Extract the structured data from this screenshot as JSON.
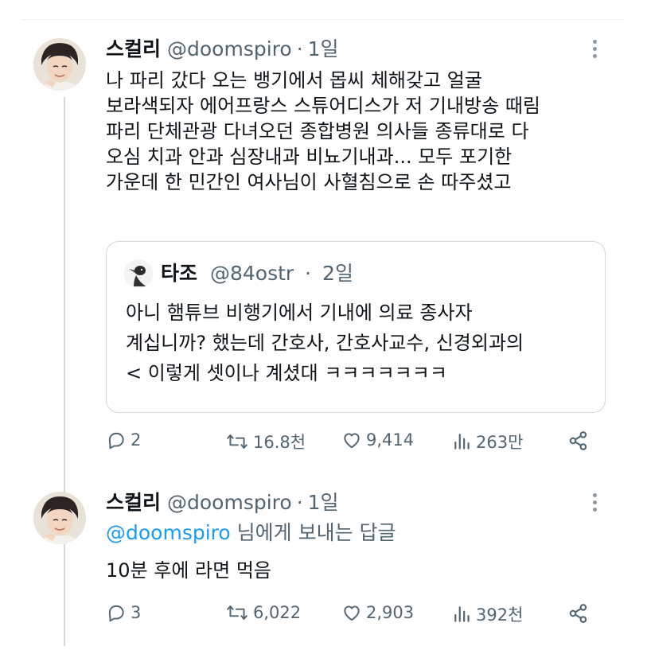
{
  "tweets": [
    {
      "name": "스컬리",
      "handle": "@doomspiro",
      "separator": "·",
      "time": "1일",
      "lines": [
        "나 파리 갔다 오는 뱅기에서 몹씨 체해갖고 얼굴",
        "보라색되자 에어프랑스 스튜어디스가 저 기내방송 때림",
        "파리 단체관광 다녀오던 종합병원 의사들 종류대로 다",
        "오심 치과 안과 심장내과 비뇨기내과... 모두 포기한",
        "가운데 한 민간인 여사님이 사혈침으로 손 따주셨고"
      ],
      "quote": {
        "name": "타조",
        "handle": "@84ostr",
        "separator": "·",
        "time": "2일",
        "lines": [
          "아니 햄튜브 비행기에서 기내에 의료 종사자",
          "계십니까? 했는데 간호사, 간호사교수, 신경외과의",
          "< 이렇게 셋이나 계셨대 ㅋㅋㅋㅋㅋㅋㅋ"
        ]
      },
      "actions": {
        "replies": "2",
        "retweets": "16.8천",
        "likes": "9,414",
        "views": "263만"
      }
    },
    {
      "name": "스컬리",
      "handle": "@doomspiro",
      "separator": "·",
      "time": "1일",
      "reply_to_handle": "@doomspiro",
      "reply_to_suffix": " 님에게 보내는 답글",
      "lines": [
        "10분 후에 라면 먹음"
      ],
      "actions": {
        "replies": "3",
        "retweets": "6,022",
        "likes": "2,903",
        "views": "392천"
      }
    }
  ],
  "colors": {
    "text": "#0f1419",
    "muted": "#536471",
    "link": "#1d9bf0",
    "border": "#cfd9de"
  },
  "icons": [
    "reply-icon",
    "retweet-icon",
    "like-icon",
    "views-icon",
    "share-icon",
    "more-icon"
  ]
}
